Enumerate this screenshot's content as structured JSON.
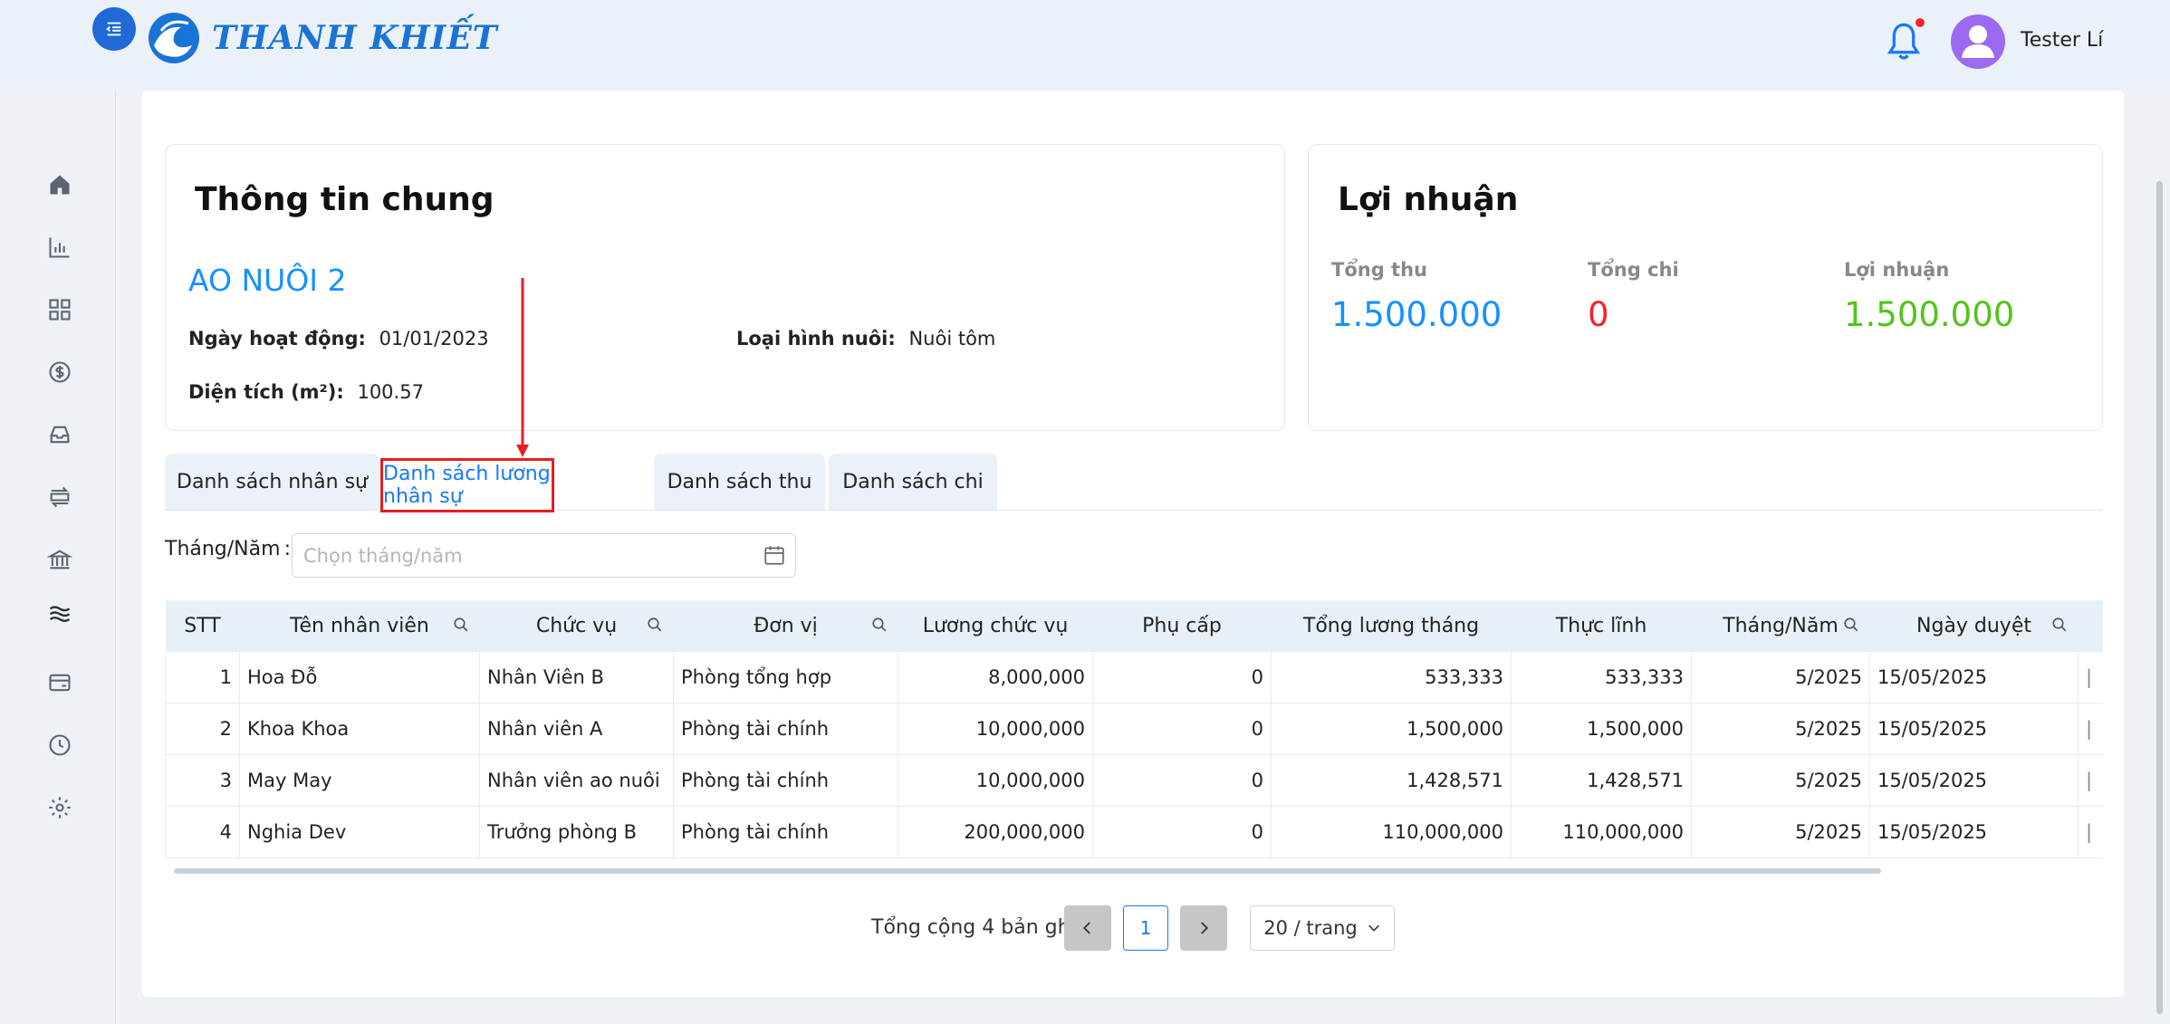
{
  "brand": {
    "name": "THANH KHIẾT"
  },
  "user": {
    "name": "Tester Lí"
  },
  "sidebar": {
    "items": [
      {
        "icon": "home-icon"
      },
      {
        "icon": "chart-icon"
      },
      {
        "icon": "grid-icon"
      },
      {
        "icon": "dollar-icon"
      },
      {
        "icon": "inbox-icon"
      },
      {
        "icon": "transfer-icon"
      },
      {
        "icon": "bank-icon"
      },
      {
        "icon": "waves-icon"
      },
      {
        "icon": "card-icon"
      },
      {
        "icon": "clock-icon"
      },
      {
        "icon": "settings-icon"
      }
    ]
  },
  "info": {
    "title": "Thông tin chung",
    "pond": "AO NUÔI 2",
    "start_label": "Ngày hoạt động:",
    "start_value": "01/01/2023",
    "type_label": "Loại hình nuôi:",
    "type_value": "Nuôi tôm",
    "area_label": "Diện tích (m²):",
    "area_value": "100.57"
  },
  "profit": {
    "title": "Lợi nhuận",
    "income_label": "Tổng thu",
    "income_value": "1.500.000",
    "income_color": "#1890ff",
    "expense_label": "Tổng chi",
    "expense_value": "0",
    "expense_color": "#f5222d",
    "profit_label": "Lợi nhuận",
    "profit_value": "1.500.000",
    "profit_color": "#52c41a"
  },
  "tabs": [
    {
      "label": "Danh sách nhân sự"
    },
    {
      "label": "Danh sách lương nhân sự",
      "active": true
    },
    {
      "label": "Danh sách thu"
    },
    {
      "label": "Danh sách chi"
    }
  ],
  "filter": {
    "label": "Tháng/Năm",
    "placeholder": "Chọn tháng/năm"
  },
  "table": {
    "headers": {
      "stt": "STT",
      "name": "Tên nhân viên",
      "position": "Chức vụ",
      "unit": "Đơn vị",
      "salary": "Lương chức vụ",
      "allowance": "Phụ cấp",
      "total": "Tổng lương tháng",
      "net": "Thực lĩnh",
      "month": "Tháng/Năm",
      "approved": "Ngày duyệt"
    },
    "rows": [
      {
        "stt": "1",
        "name": "Hoa Đỗ",
        "position": "Nhân Viên B",
        "unit": "Phòng tổng hợp",
        "salary": "8,000,000",
        "allowance": "0",
        "total": "533,333",
        "net": "533,333",
        "month": "5/2025",
        "approved": "15/05/2025"
      },
      {
        "stt": "2",
        "name": "Khoa Khoa",
        "position": "Nhân viên A",
        "unit": "Phòng tài chính",
        "salary": "10,000,000",
        "allowance": "0",
        "total": "1,500,000",
        "net": "1,500,000",
        "month": "5/2025",
        "approved": "15/05/2025"
      },
      {
        "stt": "3",
        "name": "May May",
        "position": "Nhân viên ao nuôi",
        "unit": "Phòng tài chính",
        "salary": "10,000,000",
        "allowance": "0",
        "total": "1,428,571",
        "net": "1,428,571",
        "month": "5/2025",
        "approved": "15/05/2025"
      },
      {
        "stt": "4",
        "name": "Nghia Dev",
        "position": "Trưởng phòng B",
        "unit": "Phòng tài chính",
        "salary": "200,000,000",
        "allowance": "0",
        "total": "110,000,000",
        "net": "110,000,000",
        "month": "5/2025",
        "approved": "15/05/2025"
      }
    ]
  },
  "pagination": {
    "total_text": "Tổng cộng 4 bản ghi",
    "current": "1",
    "page_size": "20 / trang"
  }
}
